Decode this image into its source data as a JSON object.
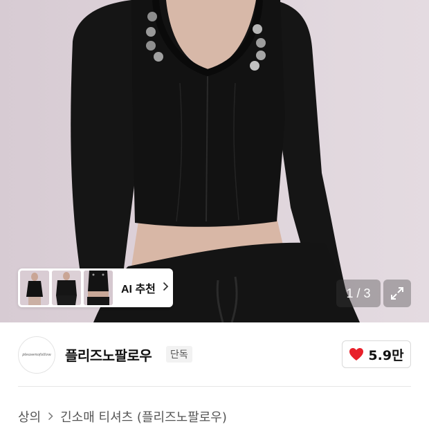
{
  "gallery": {
    "ai_recommend_label": "AI 추천",
    "pager": "1 / 3",
    "current_page": 1,
    "total_pages": 3
  },
  "shop": {
    "logo_text": "pleasenofollow",
    "name": "플리즈노팔로우",
    "badge": "단독",
    "likes": "5.9만"
  },
  "breadcrumb": {
    "category": "상의",
    "subcategory": "긴소매 티셔츠 (플리즈노팔로우)"
  },
  "colors": {
    "heart": "#e8202a",
    "garment": "#111111",
    "background": "#ddd2d9"
  },
  "icons": {
    "chevron": "chevron-right-icon",
    "expand": "expand-icon",
    "heart": "heart-icon"
  }
}
